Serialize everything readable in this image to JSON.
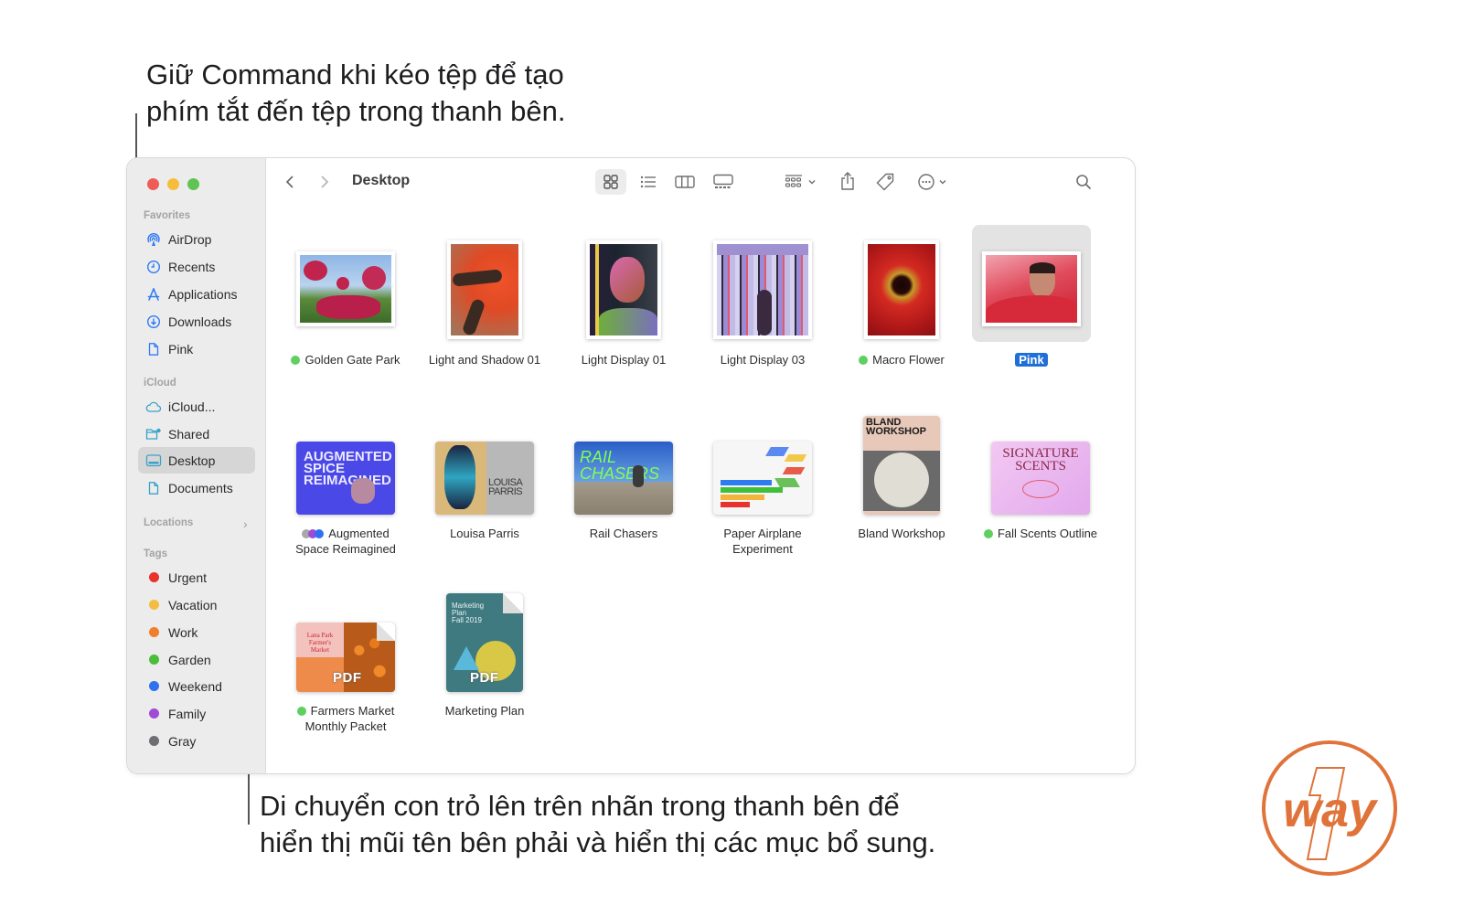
{
  "callouts": {
    "top_line1": "Giữ Command khi kéo tệp để tạo",
    "top_line2": "phím tắt đến tệp trong thanh bên.",
    "bottom_line1": "Di chuyển con trỏ lên trên nhãn trong thanh bên để",
    "bottom_line2": "hiển thị mũi tên bên phải và hiển thị các mục bổ sung."
  },
  "window": {
    "title": "Desktop",
    "traffic_lights": {
      "close": "#ee5d55",
      "minimize": "#f6bd3b",
      "zoom": "#5fc453"
    }
  },
  "toolbar": {
    "back_icon": "chevron-left",
    "forward_icon": "chevron-right",
    "view_modes": [
      "icon-view",
      "list-view",
      "column-view",
      "gallery-view"
    ],
    "selected_view": "icon-view",
    "group_icon": "group-by",
    "share_icon": "share",
    "tag_icon": "tag",
    "more_icon": "ellipsis-circle",
    "search_icon": "magnifying-glass"
  },
  "sidebar": {
    "favorites": {
      "title": "Favorites",
      "items": [
        {
          "label": "AirDrop",
          "icon": "airdrop"
        },
        {
          "label": "Recents",
          "icon": "clock"
        },
        {
          "label": "Applications",
          "icon": "applications"
        },
        {
          "label": "Downloads",
          "icon": "download"
        },
        {
          "label": "Pink",
          "icon": "document"
        }
      ]
    },
    "icloud": {
      "title": "iCloud",
      "items": [
        {
          "label": "iCloud...",
          "icon": "cloud"
        },
        {
          "label": "Shared",
          "icon": "shared-folder"
        },
        {
          "label": "Desktop",
          "icon": "desktop",
          "selected": true
        },
        {
          "label": "Documents",
          "icon": "document"
        }
      ]
    },
    "locations": {
      "title": "Locations",
      "chevron": "›"
    },
    "tags": {
      "title": "Tags",
      "items": [
        {
          "label": "Urgent",
          "color": "#e8322c"
        },
        {
          "label": "Vacation",
          "color": "#f2bd41"
        },
        {
          "label": "Work",
          "color": "#f07f2d"
        },
        {
          "label": "Garden",
          "color": "#4bbd3a"
        },
        {
          "label": "Weekend",
          "color": "#2f72f0"
        },
        {
          "label": "Family",
          "color": "#a04bd6"
        },
        {
          "label": "Gray",
          "color": "#6e6e73"
        }
      ]
    }
  },
  "files": [
    {
      "name": "Golden Gate Park",
      "tag": "#5fcf5f"
    },
    {
      "name": "Light and Shadow 01"
    },
    {
      "name": "Light Display 01"
    },
    {
      "name": "Light Display 03"
    },
    {
      "name": "Macro Flower",
      "tag": "#5fcf5f"
    },
    {
      "name": "Pink",
      "selected": true
    },
    {
      "name_line1": "Augmented",
      "name_line2": "Space Reimagined",
      "multi_tags": [
        "#a8a8a8",
        "#a04bd6",
        "#2f72f0"
      ],
      "thumb_text": "AUGMENTED SPICE REIMAGINED"
    },
    {
      "name": "Louisa Parris",
      "thumb_text": "LOUISA PARRIS"
    },
    {
      "name": "Rail Chasers",
      "thumb_text": "RAIL CHASERS"
    },
    {
      "name_line1": "Paper Airplane",
      "name_line2": "Experiment"
    },
    {
      "name": "Bland Workshop",
      "thumb_text": "BLAND WORKSHOP"
    },
    {
      "name": "Fall Scents Outline",
      "tag": "#5fcf5f",
      "thumb_text": "SIGNATURE SCENTS"
    },
    {
      "name_line1": "Farmers Market",
      "name_line2": "Monthly Packet",
      "tag": "#5fcf5f",
      "badge": "PDF",
      "thumb_text": "Lana Park Farmer's Market"
    },
    {
      "name": "Marketing Plan",
      "badge": "PDF",
      "thumb_text": "Marketing Plan Fall 2019"
    }
  ],
  "logo": {
    "text": "way",
    "numeral": "1",
    "color": "#e0733a"
  }
}
